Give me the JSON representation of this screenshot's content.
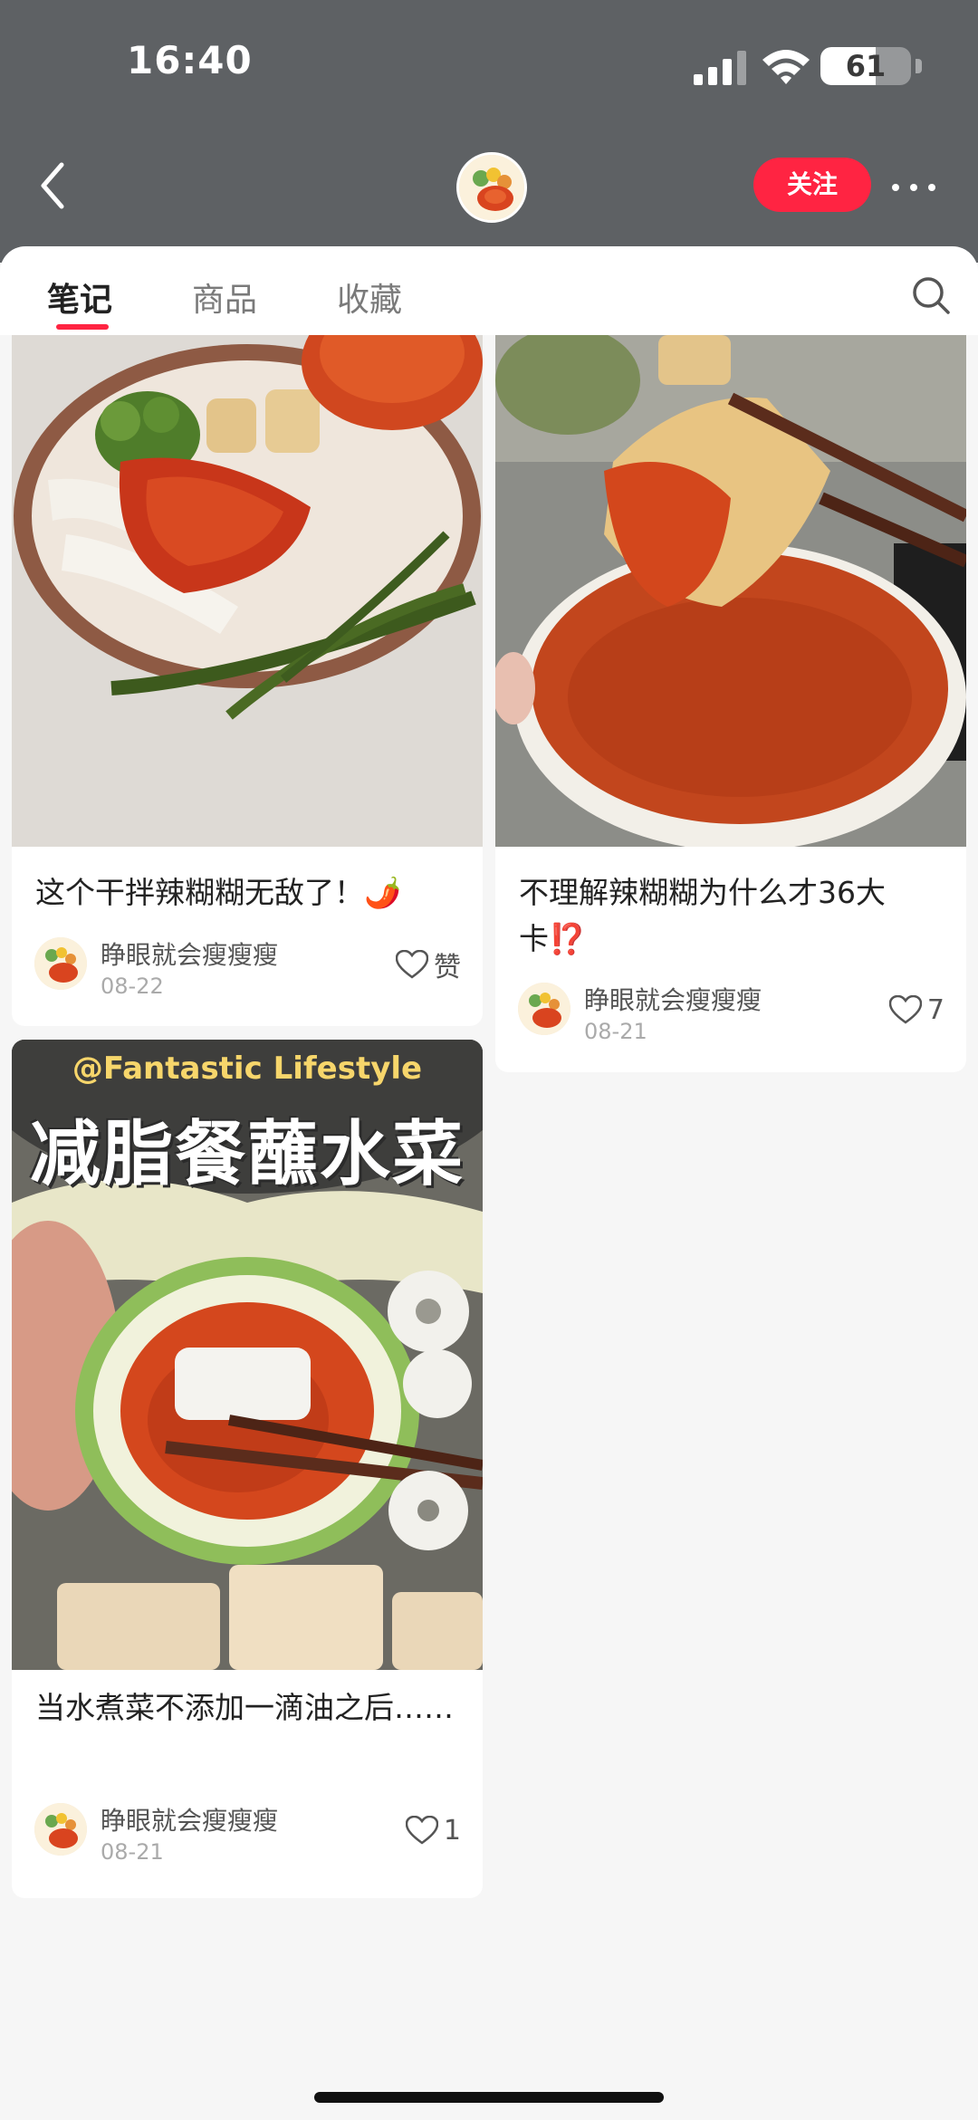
{
  "status_bar": {
    "time": "16:40",
    "battery": "61",
    "battery_level": 0.61
  },
  "header": {
    "follow_label": "关注"
  },
  "tabs": [
    {
      "label": "笔记",
      "active": true
    },
    {
      "label": "商品",
      "active": false
    },
    {
      "label": "收藏",
      "active": false
    }
  ],
  "notes": [
    {
      "title": "这个干拌辣糊糊无敌了！🌶️",
      "author": "睁眼就会瘦瘦瘦",
      "date": "08-22",
      "likes": "赞"
    },
    {
      "title": "不理解辣糊糊为什么才36大卡⁉️",
      "author": "睁眼就会瘦瘦瘦",
      "date": "08-21",
      "likes": "7"
    },
    {
      "title": "当水煮菜不添加一滴油之后……",
      "author": "睁眼就会瘦瘦瘦",
      "date": "08-21",
      "likes": "1",
      "image_overlay": {
        "line1": "@Fantastic Lifestyle",
        "line2": "减脂餐蘸水菜"
      }
    }
  ],
  "colors": {
    "accent": "#ff2442",
    "header_bg": "#5e6164",
    "page_bg": "#f6f6f6"
  },
  "icons": [
    "back-chevron-icon",
    "more-dots-icon",
    "search-icon",
    "heart-icon",
    "signal-icon",
    "wifi-icon",
    "battery-icon"
  ]
}
